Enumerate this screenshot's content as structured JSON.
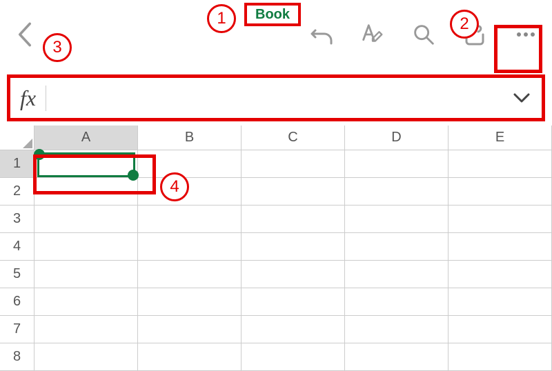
{
  "header": {
    "title": "Book"
  },
  "toolbar": {
    "undo_label": "Undo",
    "format_label": "Format",
    "search_label": "Search",
    "share_label": "Share",
    "more_label": "More"
  },
  "formula_bar": {
    "fx": "fx",
    "value": "",
    "placeholder": ""
  },
  "grid": {
    "columns": [
      "A",
      "B",
      "C",
      "D",
      "E"
    ],
    "rows": [
      "1",
      "2",
      "3",
      "4",
      "5",
      "6",
      "7",
      "8"
    ],
    "selected_cell": "A1"
  },
  "annotations": {
    "a1": "1",
    "a2": "2",
    "a3": "3",
    "a4": "4"
  }
}
